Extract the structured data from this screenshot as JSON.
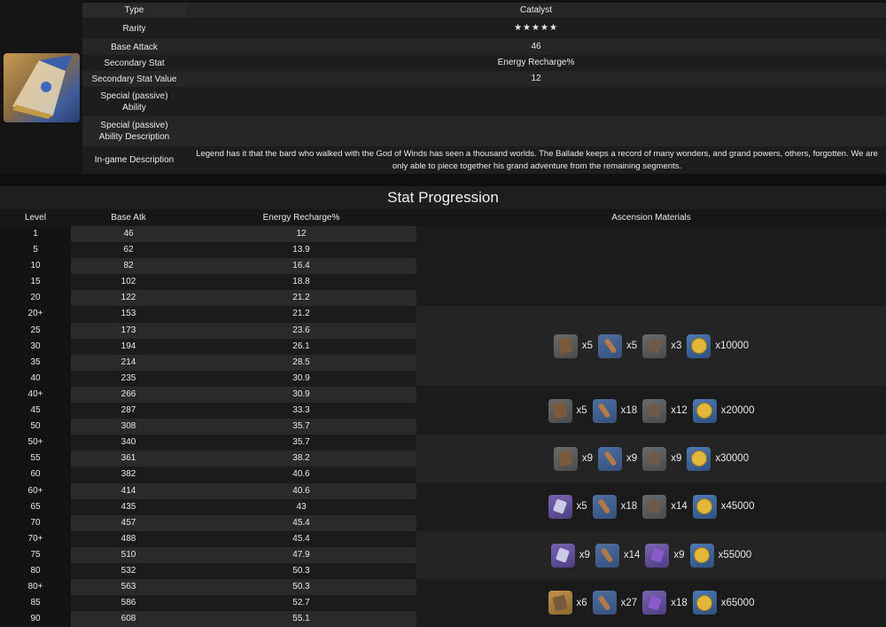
{
  "info": {
    "type_label": "Type",
    "type_value": "Catalyst",
    "rarity_label": "Rarity",
    "rarity_stars": "★★★★★",
    "base_attack_label": "Base Attack",
    "base_attack_value": "46",
    "secondary_stat_label": "Secondary Stat",
    "secondary_stat_value": "Energy Recharge%",
    "secondary_stat_value_label": "Secondary Stat Value",
    "secondary_stat_value_value": "12",
    "ability_label_1": "Special (passive)",
    "ability_label_2": "Ability",
    "ability_desc_label_1": "Special (passive)",
    "ability_desc_label_2": "Ability Description",
    "ingame_desc_label": "In-game Description",
    "ingame_desc_value": "Legend has it that the bard who walked with the God of Winds has seen a thousand worlds. The Ballade keeps a record of many wonders, and grand powers, others, forgotten. We are only able to piece together his grand adventure from the remaining segments."
  },
  "progression": {
    "title": "Stat Progression",
    "headers": {
      "level": "Level",
      "atk": "Base Atk",
      "er": "Energy Recharge%",
      "materials": "Ascension Materials"
    },
    "rows": [
      {
        "lv": "1",
        "atk": "46",
        "er": "12"
      },
      {
        "lv": "5",
        "atk": "62",
        "er": "13.9"
      },
      {
        "lv": "10",
        "atk": "82",
        "er": "16.4"
      },
      {
        "lv": "15",
        "atk": "102",
        "er": "18.8"
      },
      {
        "lv": "20",
        "atk": "122",
        "er": "21.2"
      },
      {
        "lv": "20+",
        "atk": "153",
        "er": "21.2"
      },
      {
        "lv": "25",
        "atk": "173",
        "er": "23.6"
      },
      {
        "lv": "30",
        "atk": "194",
        "er": "26.1"
      },
      {
        "lv": "35",
        "atk": "214",
        "er": "28.5"
      },
      {
        "lv": "40",
        "atk": "235",
        "er": "30.9"
      },
      {
        "lv": "40+",
        "atk": "266",
        "er": "30.9"
      },
      {
        "lv": "45",
        "atk": "287",
        "er": "33.3"
      },
      {
        "lv": "50",
        "atk": "308",
        "er": "35.7"
      },
      {
        "lv": "50+",
        "atk": "340",
        "er": "35.7"
      },
      {
        "lv": "55",
        "atk": "361",
        "er": "38.2"
      },
      {
        "lv": "60",
        "atk": "382",
        "er": "40.6"
      },
      {
        "lv": "60+",
        "atk": "414",
        "er": "40.6"
      },
      {
        "lv": "65",
        "atk": "435",
        "er": "43"
      },
      {
        "lv": "70",
        "atk": "457",
        "er": "45.4"
      },
      {
        "lv": "70+",
        "atk": "488",
        "er": "45.4"
      },
      {
        "lv": "75",
        "atk": "510",
        "er": "47.9"
      },
      {
        "lv": "80",
        "atk": "532",
        "er": "50.3"
      },
      {
        "lv": "80+",
        "atk": "563",
        "er": "50.3"
      },
      {
        "lv": "85",
        "atk": "586",
        "er": "52.7"
      },
      {
        "lv": "90",
        "atk": "608",
        "er": "55.1"
      }
    ],
    "materials": [
      {
        "items": [
          {
            "icon": "book-icon",
            "count": "x5"
          },
          {
            "icon": "horn-icon",
            "count": "x5"
          },
          {
            "icon": "scrap-icon",
            "count": "x3"
          },
          {
            "icon": "mora-coin-icon",
            "count": "x10000"
          }
        ]
      },
      {
        "items": [
          {
            "icon": "book-icon",
            "count": "x5"
          },
          {
            "icon": "horn-icon",
            "count": "x18"
          },
          {
            "icon": "scrap-icon",
            "count": "x12"
          },
          {
            "icon": "mora-coin-icon",
            "count": "x20000"
          }
        ]
      },
      {
        "items": [
          {
            "icon": "book-icon",
            "count": "x9"
          },
          {
            "icon": "horn-icon",
            "count": "x9"
          },
          {
            "icon": "scrap-icon",
            "count": "x9"
          },
          {
            "icon": "mora-coin-icon",
            "count": "x30000"
          }
        ]
      },
      {
        "items": [
          {
            "icon": "gem-icon",
            "count": "x5"
          },
          {
            "icon": "horn-icon",
            "count": "x18"
          },
          {
            "icon": "scrap-icon",
            "count": "x14"
          },
          {
            "icon": "mora-coin-icon",
            "count": "x45000"
          }
        ]
      },
      {
        "items": [
          {
            "icon": "gem-icon",
            "count": "x9"
          },
          {
            "icon": "horn-icon",
            "count": "x14"
          },
          {
            "icon": "purple-crystal-icon",
            "count": "x9"
          },
          {
            "icon": "mora-coin-icon",
            "count": "x55000"
          }
        ]
      },
      {
        "items": [
          {
            "icon": "amber-book-icon",
            "count": "x6"
          },
          {
            "icon": "horn-icon",
            "count": "x27"
          },
          {
            "icon": "purple-crystal-icon",
            "count": "x18"
          },
          {
            "icon": "mora-coin-icon",
            "count": "x65000"
          }
        ]
      }
    ]
  }
}
